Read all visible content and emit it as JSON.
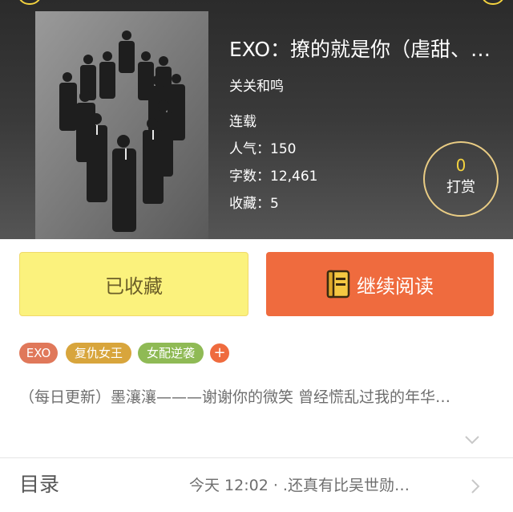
{
  "book": {
    "title": "EXO：撩的就是你（虐甜、…",
    "author": "关关和鸣",
    "status": "连载",
    "popularity_label": "人气：150",
    "word_count_label": "字数：12,461",
    "favorites_label": "收藏：5"
  },
  "tip": {
    "count": "0",
    "label": "打赏"
  },
  "actions": {
    "collected_label": "已收藏",
    "continue_label": "继续阅读"
  },
  "tags": [
    {
      "label": "EXO",
      "color": "#e0785a"
    },
    {
      "label": "复仇女王",
      "color": "#d8a53c"
    },
    {
      "label": "女配逆袭",
      "color": "#8fba55"
    }
  ],
  "tag_add_symbol": "+",
  "intro": "（每日更新）墨瀼瀼———谢谢你的微笑 曾经慌乱过我的年华…",
  "toc": {
    "label": "目录",
    "latest": "今天 12:02 · .还真有比吴世勋…"
  },
  "icons": {
    "expand": "chevron-down-icon",
    "toc_arrow": "chevron-right-icon",
    "continue": "book-icon"
  },
  "colors": {
    "accent_orange": "#ef6b3e",
    "collected_yellow": "#fbf27d",
    "tip_gold": "#f3d23f"
  }
}
